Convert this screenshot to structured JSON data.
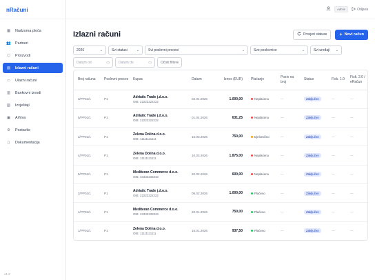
{
  "app": {
    "brand": "nRačuni",
    "version": "v1.2"
  },
  "sidebar": {
    "items": [
      {
        "label": "Nadzorna ploča",
        "icon": "dashboard-icon",
        "glyph": "▦",
        "active": false
      },
      {
        "label": "Partneri",
        "icon": "users-icon",
        "glyph": "👥",
        "active": false
      },
      {
        "label": "Proizvodi",
        "icon": "package-icon",
        "glyph": "⬡",
        "active": false
      },
      {
        "label": "Izlazni računi",
        "icon": "file-icon",
        "glyph": "▤",
        "active": true
      },
      {
        "label": "Ulazni računi",
        "icon": "inbox-icon",
        "glyph": "▭",
        "active": false
      },
      {
        "label": "Bankovni izvodi",
        "icon": "bank-icon",
        "glyph": "▥",
        "active": false
      },
      {
        "label": "Izvještaji",
        "icon": "report-icon",
        "glyph": "▧",
        "active": false
      },
      {
        "label": "Arhiva",
        "icon": "archive-icon",
        "glyph": "▣",
        "active": false
      },
      {
        "label": "Postavke",
        "icon": "gear-icon",
        "glyph": "⚙",
        "active": false
      },
      {
        "label": "Dokumentacija",
        "icon": "book-icon",
        "glyph": "▯",
        "active": false
      }
    ]
  },
  "topbar": {
    "role": "Admin",
    "logout_label": "Odjava"
  },
  "page": {
    "title": "Izlazni računi",
    "check_status_label": "Provjeri statuse",
    "new_invoice_label": "Novi račun"
  },
  "filters": {
    "year": "2026",
    "status": "Svi statusi",
    "process": "Svi poslovni procesi",
    "space": "Sve poslovnice",
    "device": "Svi uređaji",
    "date_from": "Datum od",
    "date_to": "Datum do",
    "reset_label": "Očisti filtere"
  },
  "table": {
    "headers": {
      "number": "Broj računa",
      "process": "Poslovni proces",
      "buyer": "Kupac",
      "date": "Datum",
      "amount": "Iznos (EUR)",
      "payment": "Plaćanje",
      "post": "Poziv na broj",
      "status": "Status",
      "fisk1": "Fisk. 1.0",
      "fisk2": "Fisk. 2.0 / eRačun"
    },
    "rows": [
      {
        "number": "3/PP01/1",
        "process": "P1",
        "buyer": "Adriatic Trade j.d.o.o.",
        "oib": "OIB: 22222222222",
        "date": "02.04.2026",
        "amount": "1.000,00",
        "payment": "Neplaćeno",
        "payment_color": "#ef4444",
        "post": "—",
        "status": "Zaključen",
        "fisk1": "—",
        "fisk2": "—"
      },
      {
        "number": "5/PP01/1",
        "process": "P1",
        "buyer": "Adriatic Trade j.d.o.o.",
        "oib": "OIB: 22222222222",
        "date": "01.04.2026",
        "amount": "631,25",
        "payment": "Neplaćeno",
        "payment_color": "#ef4444",
        "post": "—",
        "status": "Zaključen",
        "fisk1": "—",
        "fisk2": "—"
      },
      {
        "number": "2/PP01/1",
        "process": "P1",
        "buyer": "Zelena Dolina d.o.o.",
        "oib": "OIB: 11111111111",
        "date": "15.03.2026",
        "amount": "750,00",
        "payment": "Djelomično",
        "payment_color": "#f59e0b",
        "post": "—",
        "status": "Zaključen",
        "fisk1": "—",
        "fisk2": "—"
      },
      {
        "number": "4/PP01/1",
        "process": "P1",
        "buyer": "Zelena Dolina d.o.o.",
        "oib": "OIB: 11111111111",
        "date": "10.03.2026",
        "amount": "1.875,00",
        "payment": "Neplaćeno",
        "payment_color": "#ef4444",
        "post": "—",
        "status": "Zaključen",
        "fisk1": "—",
        "fisk2": "—"
      },
      {
        "number": "5/PP01/1",
        "process": "P1",
        "buyer": "Mediteran Commerce d.o.o.",
        "oib": "OIB: 33333333333",
        "date": "20.02.2026",
        "amount": "600,00",
        "payment": "Neplaćeno",
        "payment_color": "#ef4444",
        "post": "—",
        "status": "Zaključen",
        "fisk1": "—",
        "fisk2": "—"
      },
      {
        "number": "2/PP01/1",
        "process": "P1",
        "buyer": "Adriatic Trade j.d.o.o.",
        "oib": "OIB: 22222222222",
        "date": "05.02.2026",
        "amount": "1.000,00",
        "payment": "Plaćeno",
        "payment_color": "#22c55e",
        "post": "—",
        "status": "Zaključen",
        "fisk1": "—",
        "fisk2": "—"
      },
      {
        "number": "1/PP01/1",
        "process": "P1",
        "buyer": "Mediteran Commerce d.o.o.",
        "oib": "OIB: 33333333333",
        "date": "20.01.2026",
        "amount": "750,00",
        "payment": "Plaćeno",
        "payment_color": "#22c55e",
        "post": "—",
        "status": "Zaključen",
        "fisk1": "—",
        "fisk2": "—"
      },
      {
        "number": "1/PP01/1",
        "process": "P1",
        "buyer": "Zelena Dolina d.o.o.",
        "oib": "OIB: 11111111111",
        "date": "15.01.2026",
        "amount": "937,50",
        "payment": "Plaćeno",
        "payment_color": "#22c55e",
        "post": "—",
        "status": "Zaključen",
        "fisk1": "—",
        "fisk2": "—"
      }
    ]
  },
  "colors": {
    "accent": "#2563eb",
    "unpaid": "#ef4444",
    "partial": "#f59e0b",
    "paid": "#22c55e",
    "badge_bg": "#e0e7ff"
  }
}
